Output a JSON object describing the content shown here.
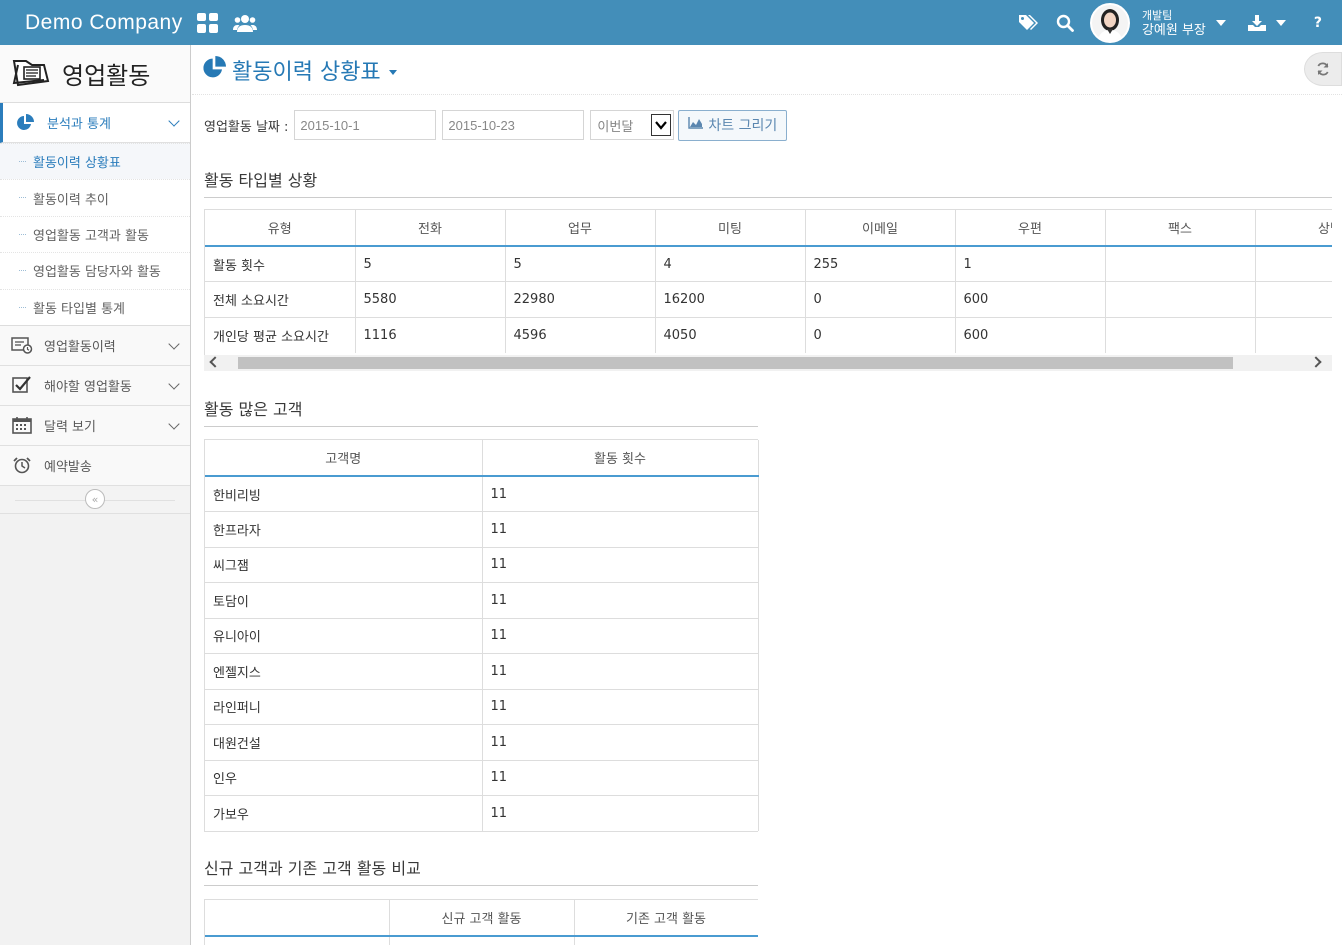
{
  "topbar": {
    "brand": "Demo Company",
    "user_team": "개발팀",
    "user_name": "강예원 부장",
    "help": "?"
  },
  "sidebar": {
    "title": "영업활동",
    "menu": [
      {
        "label": "분석과 통계",
        "icon": "pie-chart-icon",
        "active": true
      },
      {
        "label": "영업활동이력",
        "icon": "history-list-icon"
      },
      {
        "label": "해야할 영업활동",
        "icon": "checkbox-icon"
      },
      {
        "label": "달력 보기",
        "icon": "calendar-icon"
      },
      {
        "label": "예약발송",
        "icon": "alarm-clock-icon"
      }
    ],
    "submenu": [
      {
        "label": "활동이력 상황표",
        "active": true
      },
      {
        "label": "활동이력 추이"
      },
      {
        "label": "영업활동 고객과 활동"
      },
      {
        "label": "영업활동 담당자와 활동"
      },
      {
        "label": "활동 타입별 통계"
      }
    ],
    "collapse": "«"
  },
  "page": {
    "title": "활동이력 상황표",
    "filter_label": "영업활동 날짜 :",
    "date_from": "2015-10-1",
    "date_to": "2015-10-23",
    "period_select": "이번달",
    "chart_button": "차트 그리기"
  },
  "type_section": {
    "title": "활동 타입별 상황",
    "headers": [
      "유형",
      "전화",
      "업무",
      "미팅",
      "이메일",
      "우편",
      "팩스",
      "상담"
    ],
    "rows": [
      [
        "활동 횟수",
        "5",
        "5",
        "4",
        "255",
        "1",
        "",
        ""
      ],
      [
        "전체 소요시간",
        "5580",
        "22980",
        "16200",
        "0",
        "600",
        "",
        ""
      ],
      [
        "개인당 평균 소요시간",
        "1116",
        "4596",
        "4050",
        "0",
        "600",
        "",
        ""
      ]
    ]
  },
  "customer_section": {
    "title": "활동 많은 고객",
    "headers": [
      "고객명",
      "활동 횟수"
    ],
    "rows": [
      [
        "한비리빙",
        "11"
      ],
      [
        "한프라자",
        "11"
      ],
      [
        "씨그잼",
        "11"
      ],
      [
        "토담이",
        "11"
      ],
      [
        "유니아이",
        "11"
      ],
      [
        "엔젤지스",
        "11"
      ],
      [
        "라인퍼니",
        "11"
      ],
      [
        "대원건설",
        "11"
      ],
      [
        "인우",
        "11"
      ],
      [
        "가보우",
        "11"
      ]
    ]
  },
  "compare_section": {
    "title": "신규 고객과 기존 고객 활동 비교",
    "headers": [
      "",
      "신규 고객 활동",
      "기존 고객 활동"
    ]
  },
  "colors": {
    "topbar": "#438eb9",
    "accent": "#2679b5",
    "table_header_border": "#4a9bd1"
  }
}
